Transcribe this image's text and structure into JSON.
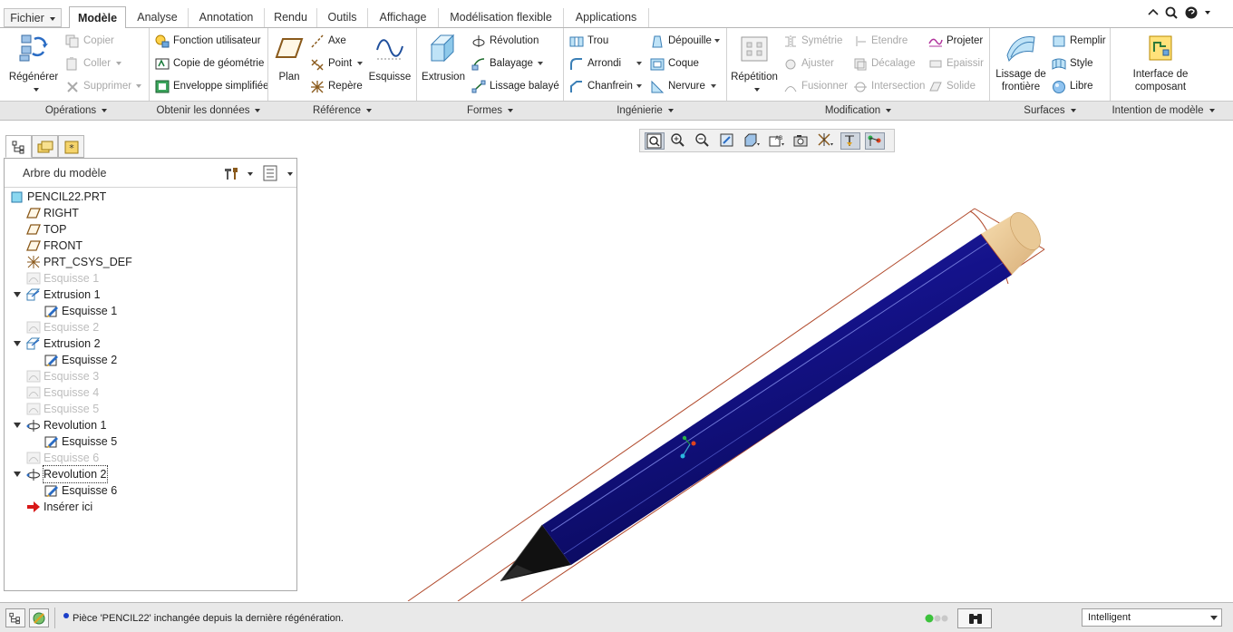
{
  "tabs": {
    "file": "Fichier",
    "model": "Modèle",
    "analysis": "Analyse",
    "annotation": "Annotation",
    "render": "Rendu",
    "tools": "Outils",
    "view": "Affichage",
    "flexible": "Modélisation flexible",
    "applications": "Applications"
  },
  "ribbon": {
    "operations": {
      "regenerate": "Régénérer",
      "copy": "Copier",
      "paste": "Coller",
      "delete": "Supprimer",
      "group": "Opérations"
    },
    "get_data": {
      "user_feature": "Fonction utilisateur",
      "copy_geometry": "Copie de géométrie",
      "shrinkwrap": "Enveloppe simplifiée",
      "group": "Obtenir les données"
    },
    "datum": {
      "plane": "Plan",
      "axis": "Axe",
      "point": "Point",
      "csys": "Repère",
      "sketch": "Esquisse",
      "group": "Référence"
    },
    "shapes": {
      "extrude": "Extrusion",
      "revolve": "Révolution",
      "sweep": "Balayage",
      "blend": "Lissage balayé",
      "group": "Formes"
    },
    "engineering": {
      "hole": "Trou",
      "round": "Arrondi",
      "chamfer": "Chanfrein",
      "draft": "Dépouille",
      "shell": "Coque",
      "rib": "Nervure",
      "group": "Ingénierie"
    },
    "editing": {
      "pattern": "Répétition",
      "mirror": "Symétrie",
      "trim": "Ajuster",
      "merge": "Fusionner",
      "extend": "Etendre",
      "offset": "Décalage",
      "intersect": "Intersection",
      "project": "Projeter",
      "thicken": "Epaissir",
      "solidify": "Solide",
      "group": "Modification"
    },
    "surfaces": {
      "boundary_line1": "Lissage de",
      "boundary_line2": "frontière",
      "fill": "Remplir",
      "style": "Style",
      "freestyle": "Libre",
      "group": "Surfaces"
    },
    "model_intent": {
      "component_interface_line1": "Interface de",
      "component_interface_line2": "composant",
      "group": "Intention de modèle"
    }
  },
  "tree": {
    "title": "Arbre du modèle",
    "items": [
      {
        "label": "PENCIL22.PRT",
        "icon": "part-icon"
      },
      {
        "label": "RIGHT",
        "icon": "datum-plane-icon"
      },
      {
        "label": "TOP",
        "icon": "datum-plane-icon"
      },
      {
        "label": "FRONT",
        "icon": "datum-plane-icon"
      },
      {
        "label": "PRT_CSYS_DEF",
        "icon": "csys-icon"
      },
      {
        "label": "Esquisse 1",
        "icon": "sketch-icon"
      },
      {
        "label": "Extrusion 1",
        "icon": "extrude-icon"
      },
      {
        "label": "Esquisse 1",
        "icon": "sketch-edit-icon"
      },
      {
        "label": "Esquisse 2",
        "icon": "sketch-icon"
      },
      {
        "label": "Extrusion 2",
        "icon": "extrude-icon"
      },
      {
        "label": "Esquisse 2",
        "icon": "sketch-edit-icon"
      },
      {
        "label": "Esquisse 3",
        "icon": "sketch-icon"
      },
      {
        "label": "Esquisse 4",
        "icon": "sketch-icon"
      },
      {
        "label": "Esquisse 5",
        "icon": "sketch-icon"
      },
      {
        "label": "Revolution 1",
        "icon": "revolve-icon"
      },
      {
        "label": "Esquisse 5",
        "icon": "sketch-edit-icon"
      },
      {
        "label": "Esquisse 6",
        "icon": "sketch-icon"
      },
      {
        "label": "Revolution 2",
        "icon": "revolve-icon"
      },
      {
        "label": "Esquisse 6",
        "icon": "sketch-edit-icon"
      },
      {
        "label": "Insérer ici",
        "icon": "insert-arrow-icon"
      }
    ]
  },
  "status": {
    "message": "Pièce 'PENCIL22' inchangée depuis la dernière régénération.",
    "filter": "Intelligent"
  },
  "colors": {
    "pencil_body": "#14128a",
    "pencil_tip": "#111111",
    "pencil_end": "#e9c996",
    "bounding_lines": "#b0482a"
  }
}
